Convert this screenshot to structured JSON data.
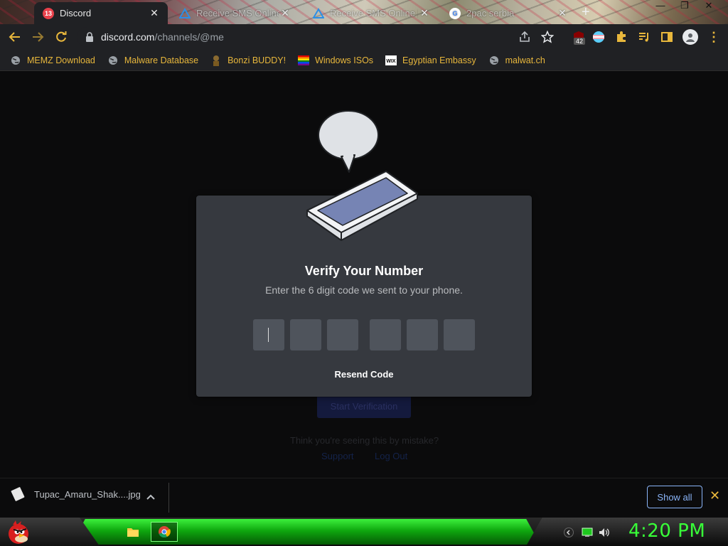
{
  "browser": {
    "tabs": [
      {
        "title": "Discord",
        "favicon_badge": "13",
        "active": true
      },
      {
        "title": "Receive SMS Online",
        "active": false
      },
      {
        "title": "Receive SMS Online |",
        "active": false
      },
      {
        "title": "2pac serbia",
        "active": false
      }
    ],
    "omnibox": {
      "domain": "discord.com",
      "path": "/channels/@me"
    },
    "extension_badge": "42"
  },
  "bookmarks": [
    {
      "label": "MEMZ Download",
      "icon": "globe-icon"
    },
    {
      "label": "Malware Database",
      "icon": "globe-icon"
    },
    {
      "label": "Bonzi BUDDY!",
      "icon": "bonzi-icon"
    },
    {
      "label": "Windows ISOs",
      "icon": "rainbow-flag-icon"
    },
    {
      "label": "Egyptian Embassy",
      "icon": "wix-icon"
    },
    {
      "label": "malwat.ch",
      "icon": "globe-icon"
    }
  ],
  "background_page": {
    "button_label": "Start Verification",
    "mistake_text": "Think you're seeing this by mistake?",
    "link_support": "Support",
    "link_logout": "Log Out"
  },
  "modal": {
    "title": "Verify Your Number",
    "subtitle": "Enter the 6 digit code we sent to your phone.",
    "code_digits": [
      "",
      "",
      "",
      "",
      "",
      ""
    ],
    "resend_label": "Resend Code"
  },
  "downloads": {
    "file_name": "Tupac_Amaru_Shak....jpg",
    "show_all_label": "Show all"
  },
  "taskbar": {
    "clock": "4:20 PM"
  },
  "colors": {
    "modal_bg": "#36393f",
    "code_box": "#4f545c",
    "accent_yellow": "#e8b73c",
    "clock_green": "#38ff38",
    "show_all_blue": "#8ab4f8"
  }
}
